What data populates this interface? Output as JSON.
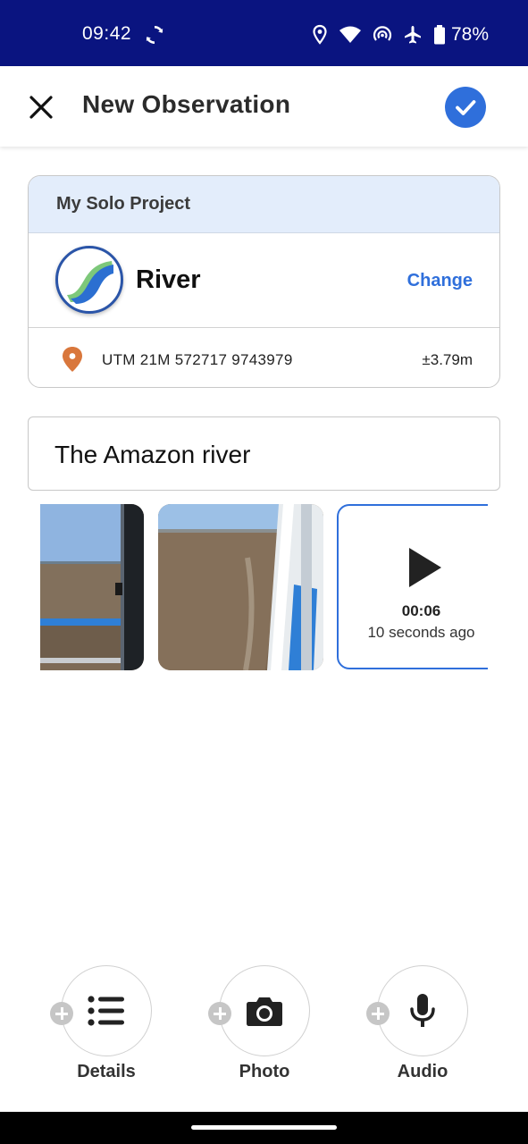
{
  "status_bar": {
    "time": "09:42",
    "battery_percent": "78%",
    "icons": [
      "sync-icon",
      "location-icon",
      "wifi-icon",
      "hotspot-icon",
      "airplane-icon",
      "battery-icon"
    ],
    "background": "#0a1480"
  },
  "app_bar": {
    "title": "New Observation",
    "close_icon": "close-icon",
    "save_icon": "check-icon",
    "accent": "#2f6fdb"
  },
  "project": {
    "name": "My Solo Project",
    "category": {
      "name": "River",
      "icon": "river-icon",
      "change_label": "Change"
    },
    "location": {
      "icon": "map-pin-icon",
      "coordinates": "UTM 21M 572717 9743979",
      "accuracy": "±3.79m"
    }
  },
  "notes": {
    "value": "The Amazon river"
  },
  "media": {
    "photos": [
      {
        "name": "photo-thumbnail-1"
      },
      {
        "name": "photo-thumbnail-2"
      }
    ],
    "audio": {
      "duration": "00:06",
      "recorded": "10 seconds ago",
      "icon": "play-icon"
    }
  },
  "actions": [
    {
      "label": "Details",
      "icon": "list-icon"
    },
    {
      "label": "Photo",
      "icon": "camera-icon"
    },
    {
      "label": "Audio",
      "icon": "microphone-icon"
    }
  ]
}
